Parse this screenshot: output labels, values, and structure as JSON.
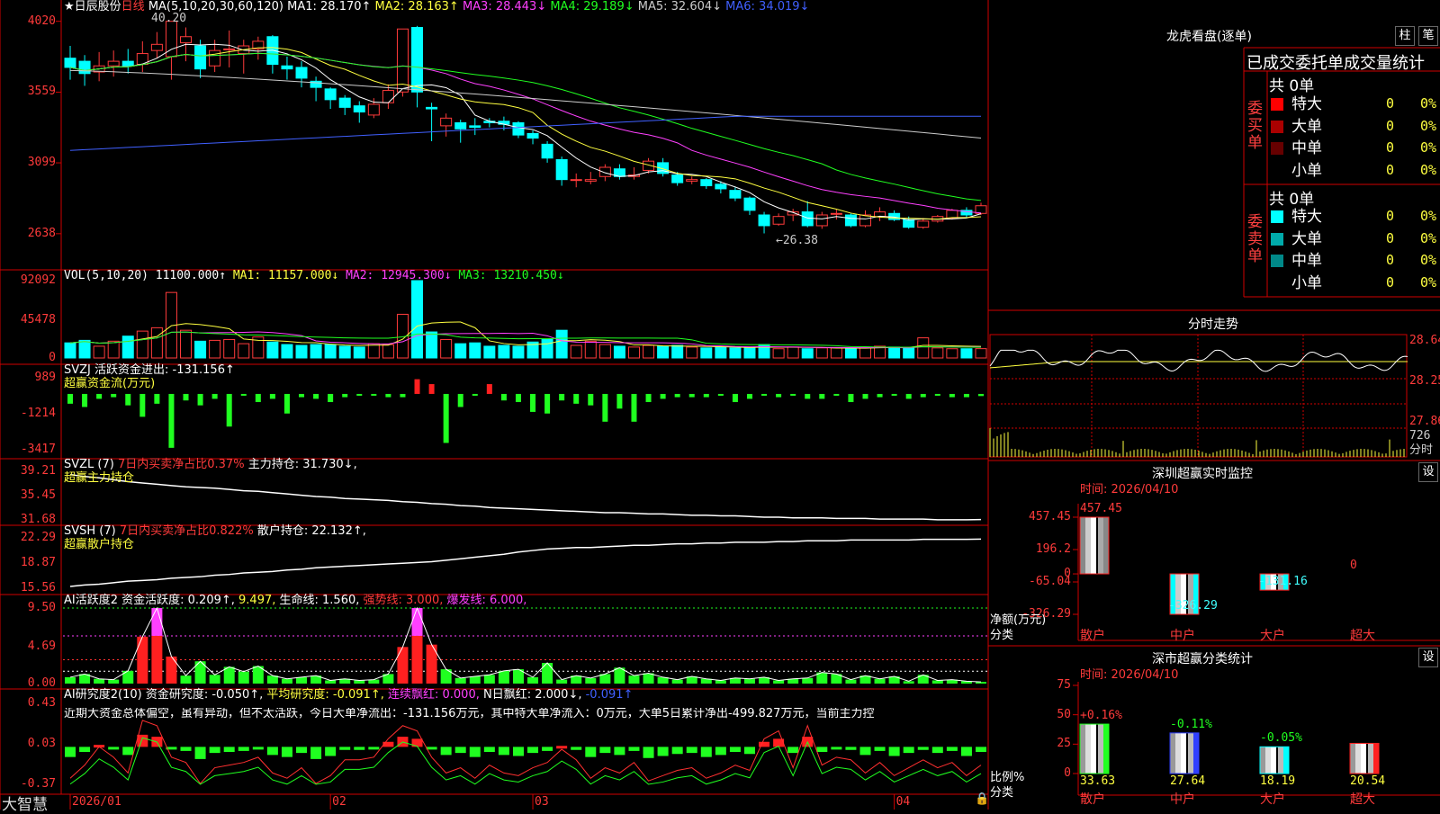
{
  "stock": {
    "name": "★日辰股份",
    "period": "日线"
  },
  "kline": {
    "legend": [
      {
        "t": "MA(5,10,20,30,60,120)",
        "c": "#ffffff"
      },
      {
        "t": "MA1: 28.170↑",
        "c": "#ffffff"
      },
      {
        "t": "MA2: 28.163↑",
        "c": "#ffff40"
      },
      {
        "t": "MA3: 28.443↓",
        "c": "#ff40ff"
      },
      {
        "t": "MA4: 29.189↓",
        "c": "#20ff20"
      },
      {
        "t": "MA5: 32.604↓",
        "c": "#cccccc"
      },
      {
        "t": "MA6: 34.019↓",
        "c": "#4060ff"
      }
    ],
    "yticks": [
      "4020",
      "3559",
      "3099",
      "2638"
    ],
    "high_note": "40.20",
    "low_note": "←26.38",
    "ohlc": [
      [
        37.8,
        37.2,
        38.6,
        36.4
      ],
      [
        37.6,
        36.8,
        38.0,
        36.0
      ],
      [
        36.9,
        37.3,
        38.2,
        36.3
      ],
      [
        37.3,
        37.6,
        38.3,
        36.6
      ],
      [
        37.6,
        37.3,
        38.4,
        36.8
      ],
      [
        37.4,
        38.1,
        38.9,
        36.9
      ],
      [
        38.3,
        38.7,
        39.5,
        37.8
      ],
      [
        37.9,
        40.2,
        40.2,
        36.4
      ],
      [
        38.8,
        39.2,
        39.8,
        37.6
      ],
      [
        38.6,
        37.1,
        39.0,
        36.5
      ],
      [
        37.3,
        38.3,
        39.0,
        36.9
      ],
      [
        38.4,
        38.4,
        39.6,
        37.2
      ],
      [
        38.1,
        38.6,
        39.0,
        36.8
      ],
      [
        38.4,
        38.9,
        39.2,
        37.7
      ],
      [
        39.2,
        37.4,
        39.3,
        36.8
      ],
      [
        37.3,
        37.1,
        37.9,
        36.4
      ],
      [
        37.2,
        36.5,
        37.6,
        35.9
      ],
      [
        36.3,
        35.9,
        36.6,
        35.0
      ],
      [
        35.8,
        35.1,
        35.9,
        34.5
      ],
      [
        35.2,
        34.6,
        35.4,
        34.1
      ],
      [
        34.7,
        34.3,
        35.0,
        33.6
      ],
      [
        34.1,
        34.8,
        35.2,
        33.9
      ],
      [
        34.9,
        35.7,
        36.1,
        34.5
      ],
      [
        35.6,
        39.7,
        39.7,
        35.3
      ],
      [
        39.8,
        35.6,
        39.9,
        34.6
      ],
      [
        34.6,
        34.5,
        34.9,
        32.4
      ],
      [
        33.4,
        33.9,
        34.2,
        32.7
      ],
      [
        33.6,
        33.2,
        33.8,
        32.3
      ],
      [
        33.4,
        33.3,
        33.9,
        32.8
      ],
      [
        33.7,
        33.6,
        33.9,
        33.3
      ],
      [
        33.7,
        33.5,
        34.0,
        33.1
      ],
      [
        33.6,
        32.8,
        33.7,
        32.6
      ],
      [
        32.9,
        32.6,
        33.1,
        32.2
      ],
      [
        32.2,
        31.3,
        32.4,
        31.0
      ],
      [
        31.2,
        29.9,
        31.4,
        29.5
      ],
      [
        29.9,
        29.9,
        30.3,
        29.4
      ],
      [
        29.8,
        29.9,
        30.4,
        29.6
      ],
      [
        30.1,
        30.7,
        30.9,
        29.8
      ],
      [
        30.6,
        30.1,
        30.9,
        29.9
      ],
      [
        30.1,
        30.2,
        30.7,
        29.9
      ],
      [
        30.5,
        31.1,
        31.3,
        30.3
      ],
      [
        31.0,
        30.3,
        31.3,
        30.1
      ],
      [
        30.2,
        29.7,
        30.4,
        29.5
      ],
      [
        29.8,
        29.9,
        30.1,
        29.6
      ],
      [
        29.9,
        29.5,
        30.0,
        29.3
      ],
      [
        29.6,
        29.3,
        29.8,
        29.0
      ],
      [
        29.2,
        28.7,
        29.4,
        28.5
      ],
      [
        28.7,
        27.9,
        28.8,
        27.6
      ],
      [
        27.6,
        26.9,
        27.8,
        26.4
      ],
      [
        27.0,
        27.5,
        27.7,
        26.9
      ],
      [
        27.6,
        27.8,
        28.0,
        27.2
      ],
      [
        27.8,
        26.9,
        28.5,
        26.8
      ],
      [
        26.9,
        27.6,
        27.8,
        26.7
      ],
      [
        27.7,
        27.7,
        28.0,
        27.3
      ],
      [
        27.6,
        26.9,
        27.7,
        26.8
      ],
      [
        26.9,
        27.6,
        27.9,
        26.8
      ],
      [
        27.5,
        27.8,
        28.1,
        27.2
      ],
      [
        27.7,
        27.3,
        27.9,
        27.2
      ],
      [
        27.3,
        26.8,
        27.5,
        26.7
      ],
      [
        26.8,
        27.2,
        27.4,
        26.7
      ],
      [
        27.2,
        27.5,
        27.6,
        27.1
      ],
      [
        27.4,
        27.9,
        28.0,
        27.3
      ],
      [
        27.9,
        27.6,
        28.1,
        27.4
      ],
      [
        27.7,
        28.2,
        28.4,
        27.6
      ]
    ]
  },
  "vol": {
    "legend": [
      {
        "t": "VOL(5,10,20)",
        "c": "#ffffff"
      },
      {
        "t": "11100.000↑",
        "c": "#ffffff"
      },
      {
        "t": "MA1: 11157.000↓",
        "c": "#ffff40"
      },
      {
        "t": "MA2: 12945.300↓",
        "c": "#ff40ff"
      },
      {
        "t": "MA3: 13210.450↓",
        "c": "#20ff20"
      }
    ],
    "yticks": [
      "92092",
      "45478",
      "0"
    ],
    "values": [
      18000,
      21000,
      14000,
      20000,
      26000,
      32000,
      36000,
      78000,
      33000,
      20000,
      21000,
      22000,
      17000,
      25000,
      19000,
      16000,
      15000,
      16000,
      16000,
      14000,
      13000,
      17000,
      16000,
      52000,
      92092,
      31000,
      22000,
      17000,
      18000,
      14000,
      15000,
      14000,
      19000,
      22000,
      33000,
      15000,
      20000,
      16000,
      14000,
      13000,
      15000,
      14000,
      15000,
      13000,
      12000,
      13000,
      12000,
      12000,
      16000,
      11000,
      13000,
      11000,
      12000,
      12000,
      11000,
      12000,
      14000,
      13000,
      12000,
      24000,
      12000,
      11000,
      11000,
      11100
    ]
  },
  "svzj": {
    "legend": [
      {
        "t": "SVZJ  活跃资金进出: -131.156↑",
        "c": "#ffffff"
      }
    ],
    "sub": "超赢资金流(万元)",
    "yticks": [
      "989",
      "-1214",
      "-3417"
    ],
    "values": [
      -600,
      -800,
      -300,
      -200,
      -700,
      -1400,
      -600,
      -3300,
      -400,
      -700,
      -300,
      -2000,
      -100,
      -500,
      -300,
      -1200,
      -200,
      -300,
      -500,
      -200,
      -100,
      -100,
      -200,
      -200,
      900,
      600,
      -3000,
      -800,
      -100,
      600,
      -400,
      -500,
      -1100,
      -1200,
      -400,
      -600,
      -700,
      -1700,
      -900,
      -1700,
      -500,
      -300,
      -200,
      -200,
      -200,
      -100,
      -500,
      -300,
      -100,
      -200,
      -100,
      -300,
      -300,
      -100,
      -500,
      -300,
      -200,
      -100,
      -300,
      -200,
      -100,
      -200,
      -200,
      -131
    ]
  },
  "svzl": {
    "legend": [
      {
        "t": "SVZL (7)",
        "c": "#ffffff"
      },
      {
        "t": "7日内买卖净占比0.37%",
        "c": "#ff3b3b"
      },
      {
        "t": "主力持仓: 31.730↓,",
        "c": "#ffffff"
      }
    ],
    "sub": "超赢主力持仓",
    "yticks": [
      "39.21",
      "35.45",
      "31.68"
    ],
    "values": [
      38.7,
      38.4,
      38.2,
      37.9,
      37.6,
      37.4,
      37.2,
      37.0,
      36.8,
      36.7,
      36.6,
      36.4,
      36.2,
      36.1,
      35.9,
      35.7,
      35.5,
      35.3,
      35.2,
      35.0,
      34.9,
      34.8,
      34.7,
      34.5,
      34.4,
      34.2,
      34.1,
      33.9,
      33.8,
      33.6,
      33.5,
      33.4,
      33.3,
      33.2,
      33.1,
      33.0,
      32.9,
      32.8,
      32.8,
      32.7,
      32.6,
      32.6,
      32.5,
      32.4,
      32.4,
      32.3,
      32.3,
      32.2,
      32.1,
      32.1,
      32.0,
      32.0,
      32.0,
      31.9,
      31.9,
      31.9,
      31.8,
      31.8,
      31.8,
      31.8,
      31.7,
      31.7,
      31.7,
      31.73
    ]
  },
  "svsh": {
    "legend": [
      {
        "t": "SVSH (7)",
        "c": "#ffffff"
      },
      {
        "t": "7日内买卖净占比0.822%",
        "c": "#ff3b3b"
      },
      {
        "t": "散户持仓: 22.132↑,",
        "c": "#ffffff"
      }
    ],
    "sub": "超赢散户持仓",
    "yticks": [
      "22.29",
      "18.87",
      "15.56"
    ],
    "values": [
      15.8,
      16.0,
      16.1,
      16.3,
      16.5,
      16.6,
      16.7,
      16.9,
      17.0,
      17.1,
      17.3,
      17.4,
      17.6,
      17.7,
      17.8,
      18.0,
      18.1,
      18.3,
      18.4,
      18.5,
      18.6,
      18.7,
      18.8,
      18.9,
      19.0,
      19.1,
      19.3,
      19.5,
      19.7,
      19.9,
      20.1,
      20.4,
      20.6,
      20.8,
      20.9,
      21.0,
      21.0,
      21.1,
      21.2,
      21.3,
      21.3,
      21.4,
      21.5,
      21.5,
      21.6,
      21.6,
      21.7,
      21.7,
      21.7,
      21.8,
      21.8,
      21.9,
      21.9,
      21.9,
      22.0,
      22.0,
      22.0,
      22.0,
      22.0,
      22.1,
      22.1,
      22.1,
      22.1,
      22.13
    ]
  },
  "ai1": {
    "legend": [
      {
        "t": "AI活跃度2",
        "c": "#ffffff"
      },
      {
        "t": "资金活跃度: 0.209↑,",
        "c": "#ffffff"
      },
      {
        "t": "9.497,",
        "c": "#ffff40"
      },
      {
        "t": "生命线: 1.560,",
        "c": "#ffffff"
      },
      {
        "t": "强势线: 3.000,",
        "c": "#ff3b3b"
      },
      {
        "t": "爆发线: 6.000,",
        "c": "#ff40ff"
      }
    ],
    "yticks": [
      "9.50",
      "4.69",
      "0.00"
    ],
    "values": [
      0.8,
      1.2,
      0.6,
      0.5,
      1.6,
      5.9,
      9.5,
      3.4,
      1.0,
      2.8,
      1.1,
      2.1,
      1.5,
      2.2,
      1.0,
      0.6,
      0.8,
      1.0,
      0.4,
      0.6,
      0.4,
      0.5,
      1.2,
      4.6,
      9.5,
      4.9,
      1.8,
      0.7,
      0.9,
      1.1,
      1.6,
      1.8,
      0.8,
      2.6,
      0.5,
      1.0,
      0.7,
      1.2,
      2.0,
      1.0,
      1.3,
      0.8,
      0.5,
      0.9,
      0.6,
      0.4,
      0.7,
      0.6,
      0.8,
      0.4,
      0.6,
      0.7,
      1.4,
      1.2,
      0.5,
      1.0,
      0.6,
      0.9,
      0.3,
      1.1,
      0.4,
      0.5,
      0.3,
      0.21
    ]
  },
  "ai2": {
    "legend": [
      {
        "t": "AI研究度2(10)",
        "c": "#ffffff"
      },
      {
        "t": "资金研究度: -0.050↑,",
        "c": "#ffffff"
      },
      {
        "t": "平均研究度: -0.091↑,",
        "c": "#ffff40"
      },
      {
        "t": "连续飘红: 0.000,",
        "c": "#ff40ff"
      },
      {
        "t": "N日飘红: 2.000↓,",
        "c": "#ffffff"
      },
      {
        "t": "-0.091↑",
        "c": "#4060ff"
      }
    ],
    "note": "近期大资金总体偏空，虽有异动，但不太活跃，今日大单净流出：-131.156万元，其中特大单净流入：0万元，大单5日累计净出-499.827万元，当前主力控",
    "yticks": [
      "0.43",
      "0.03",
      "-0.37"
    ],
    "values": [
      -0.1,
      -0.05,
      0.02,
      -0.02,
      -0.08,
      0.12,
      0.1,
      -0.02,
      -0.04,
      -0.12,
      -0.06,
      -0.05,
      -0.04,
      -0.02,
      -0.08,
      -0.1,
      -0.06,
      -0.12,
      -0.09,
      -0.03,
      -0.03,
      -0.02,
      0.05,
      0.1,
      0.08,
      -0.02,
      -0.08,
      -0.06,
      -0.1,
      -0.05,
      -0.08,
      -0.09,
      -0.06,
      -0.04,
      0.01,
      -0.03,
      -0.1,
      -0.06,
      -0.08,
      -0.04,
      -0.11,
      -0.09,
      -0.07,
      -0.06,
      -0.1,
      -0.08,
      -0.05,
      -0.07,
      0.05,
      0.08,
      -0.06,
      0.1,
      -0.05,
      -0.02,
      -0.03,
      -0.08,
      -0.04,
      -0.09,
      -0.06,
      -0.03,
      -0.06,
      -0.04,
      -0.09,
      -0.05
    ]
  },
  "dates": [
    "2026/01",
    "02",
    "03",
    "04"
  ],
  "brand": "大智慧",
  "lhb": {
    "title": "龙虎看盘(逐单)",
    "btn1": "柱",
    "btn2": "笔",
    "header": "已成交委托单成交量统计",
    "buy": {
      "label": "委买单",
      "total": "共 0单",
      "rows": [
        {
          "n": "特大",
          "c": "#ff0000",
          "v": "0",
          "p": "0%"
        },
        {
          "n": "大单",
          "c": "#aa0000",
          "v": "0",
          "p": "0%"
        },
        {
          "n": "中单",
          "c": "#660000",
          "v": "0",
          "p": "0%"
        },
        {
          "n": "小单",
          "c": "#000000",
          "v": "0",
          "p": "0%"
        }
      ]
    },
    "sell": {
      "label": "委卖单",
      "total": "共 0单",
      "rows": [
        {
          "n": "特大",
          "c": "#00ffff",
          "v": "0",
          "p": "0%"
        },
        {
          "n": "大单",
          "c": "#00aaaa",
          "v": "0",
          "p": "0%"
        },
        {
          "n": "中单",
          "c": "#008888",
          "v": "0",
          "p": "0%"
        },
        {
          "n": "小单",
          "c": "#000000",
          "v": "0",
          "p": "0%"
        }
      ]
    }
  },
  "fenshi": {
    "title": "分时走势",
    "yticks": [
      "28.64",
      "28.25",
      "27.86"
    ],
    "vol_tick": "726",
    "vol_label": "分时"
  },
  "monitor": {
    "title": "深圳超赢实时监控",
    "btn": "设",
    "time": "时间: 2026/04/10",
    "yticks": [
      "457.45",
      "196.2",
      "0",
      "-65.04",
      "-326.29"
    ],
    "ylabel": "净额(万元)",
    "xlabel": "分类",
    "bars": [
      {
        "cat": "散户",
        "v": 457.45,
        "label": "457.45"
      },
      {
        "cat": "中户",
        "v": -326.29,
        "label": "-326.29"
      },
      {
        "cat": "大户",
        "v": -131.16,
        "label": "-131.16"
      },
      {
        "cat": "超大",
        "v": 0,
        "label": "0"
      }
    ]
  },
  "stat": {
    "title": "深市超赢分类统计",
    "btn": "设",
    "time": "时间: 2026/04/10",
    "yticks": [
      "75",
      "50",
      "25",
      "0"
    ],
    "ylabel": "比例%",
    "xlabel": "分类",
    "bars": [
      {
        "cat": "散户",
        "v": 33.63,
        "chg": "+0.16%",
        "color": "#20ff20"
      },
      {
        "cat": "中户",
        "v": 27.64,
        "chg": "-0.11%",
        "color": "#3040ff"
      },
      {
        "cat": "大户",
        "v": 18.19,
        "chg": "-0.05%",
        "color": "#00ffff"
      },
      {
        "cat": "超大",
        "v": 20.54,
        "chg": "",
        "color": "#ff2020"
      }
    ]
  },
  "colors": {
    "up": "#ff3b3b",
    "down": "#00ffff",
    "grid": "#b00000"
  }
}
